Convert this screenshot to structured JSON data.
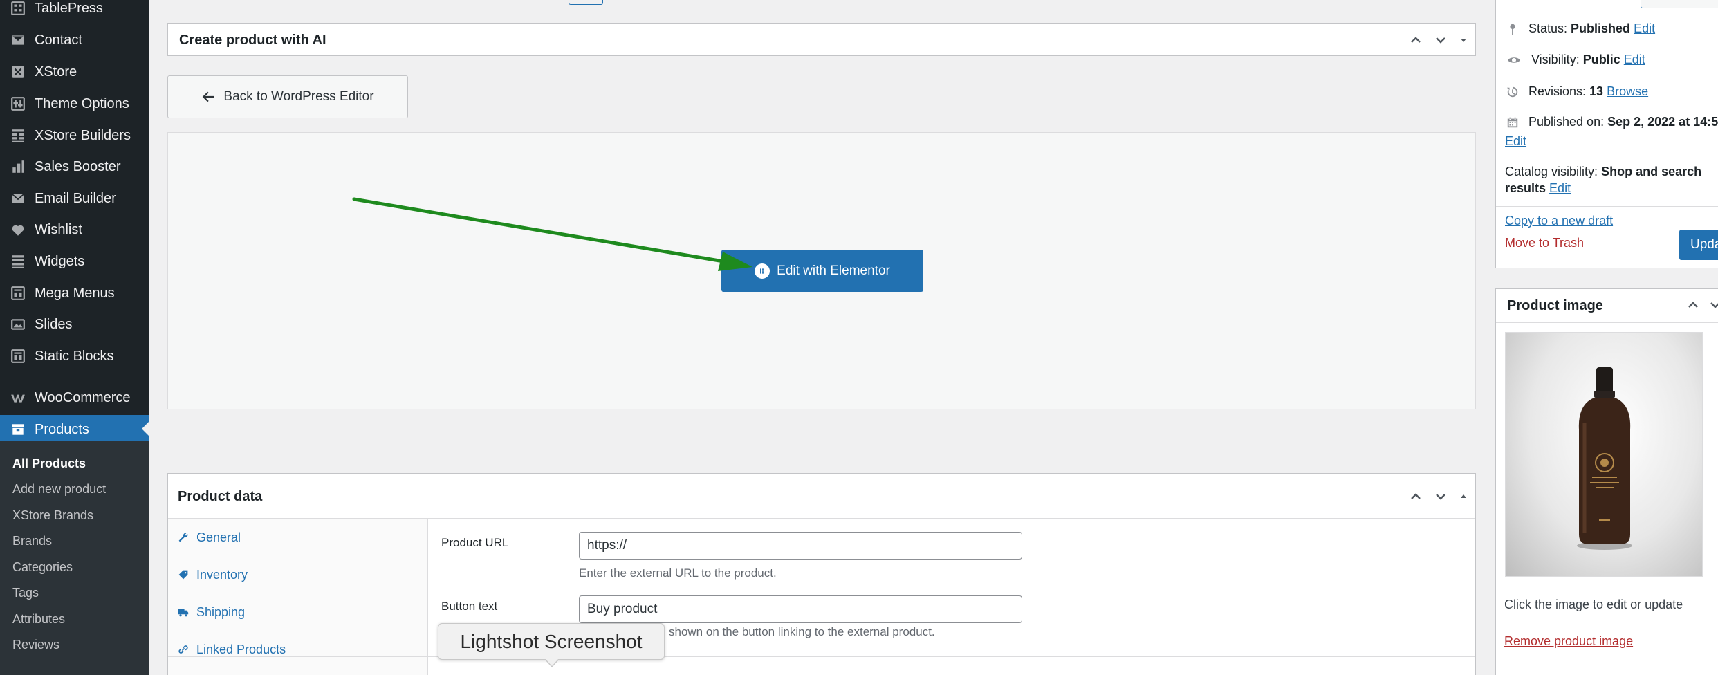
{
  "sidebar": {
    "items": [
      {
        "label": "TablePress",
        "icon": "table-icon"
      },
      {
        "label": "Contact",
        "icon": "mail-icon"
      },
      {
        "label": "XStore",
        "icon": "xstore-icon"
      },
      {
        "label": "Theme Options",
        "icon": "sliders-icon"
      },
      {
        "label": "XStore Builders",
        "icon": "grid-icon"
      },
      {
        "label": "Sales Booster",
        "icon": "bar-chart-icon"
      },
      {
        "label": "Email Builder",
        "icon": "envelope-icon"
      },
      {
        "label": "Wishlist",
        "icon": "heart-icon"
      },
      {
        "label": "Widgets",
        "icon": "widgets-icon"
      },
      {
        "label": "Mega Menus",
        "icon": "table-icon"
      },
      {
        "label": "Slides",
        "icon": "slides-icon"
      },
      {
        "label": "Static Blocks",
        "icon": "table-icon"
      }
    ],
    "woocommerce": {
      "label": "WooCommerce",
      "icon": "woocommerce-icon"
    },
    "products": {
      "label": "Products",
      "icon": "archive-icon"
    },
    "submenu": [
      "All Products",
      "Add new product",
      "XStore Brands",
      "Brands",
      "Categories",
      "Tags",
      "Attributes",
      "Reviews"
    ]
  },
  "ai_box": {
    "title": "Create product with AI"
  },
  "back_button": {
    "label": "Back to WordPress Editor"
  },
  "elementor_button": {
    "label": "Edit with Elementor",
    "color": "#2271b1"
  },
  "annotation_arrow": {
    "color": "#1e8a1e"
  },
  "product_data": {
    "title": "Product data",
    "tabs": [
      "General",
      "Inventory",
      "Shipping",
      "Linked Products"
    ],
    "fields": {
      "product_url_label": "Product URL",
      "product_url_value": "https://",
      "product_url_help": "Enter the external URL to the product.",
      "button_text_label": "Button text",
      "button_text_value": "Buy product",
      "button_text_help": "shown on the button linking to the external product."
    }
  },
  "tooltip": {
    "label": "Lightshot Screenshot"
  },
  "publish": {
    "status_label": "Status:",
    "status_value": "Published",
    "visibility_label": "Visibility:",
    "visibility_value": "Public",
    "revisions_label": "Revisions:",
    "revisions_value": "13",
    "browse": "Browse",
    "published_label": "Published on:",
    "published_value": "Sep 2, 2022 at 14:5",
    "edit": "Edit",
    "catalog_label": "Catalog visibility:",
    "catalog_value_1": "Shop and search",
    "catalog_value_2": "results",
    "copy_draft": "Copy to a new draft",
    "move_trash": "Move to Trash",
    "update": "Upda"
  },
  "product_image": {
    "title": "Product image",
    "hint": "Click the image to edit or update",
    "remove": "Remove product image"
  }
}
